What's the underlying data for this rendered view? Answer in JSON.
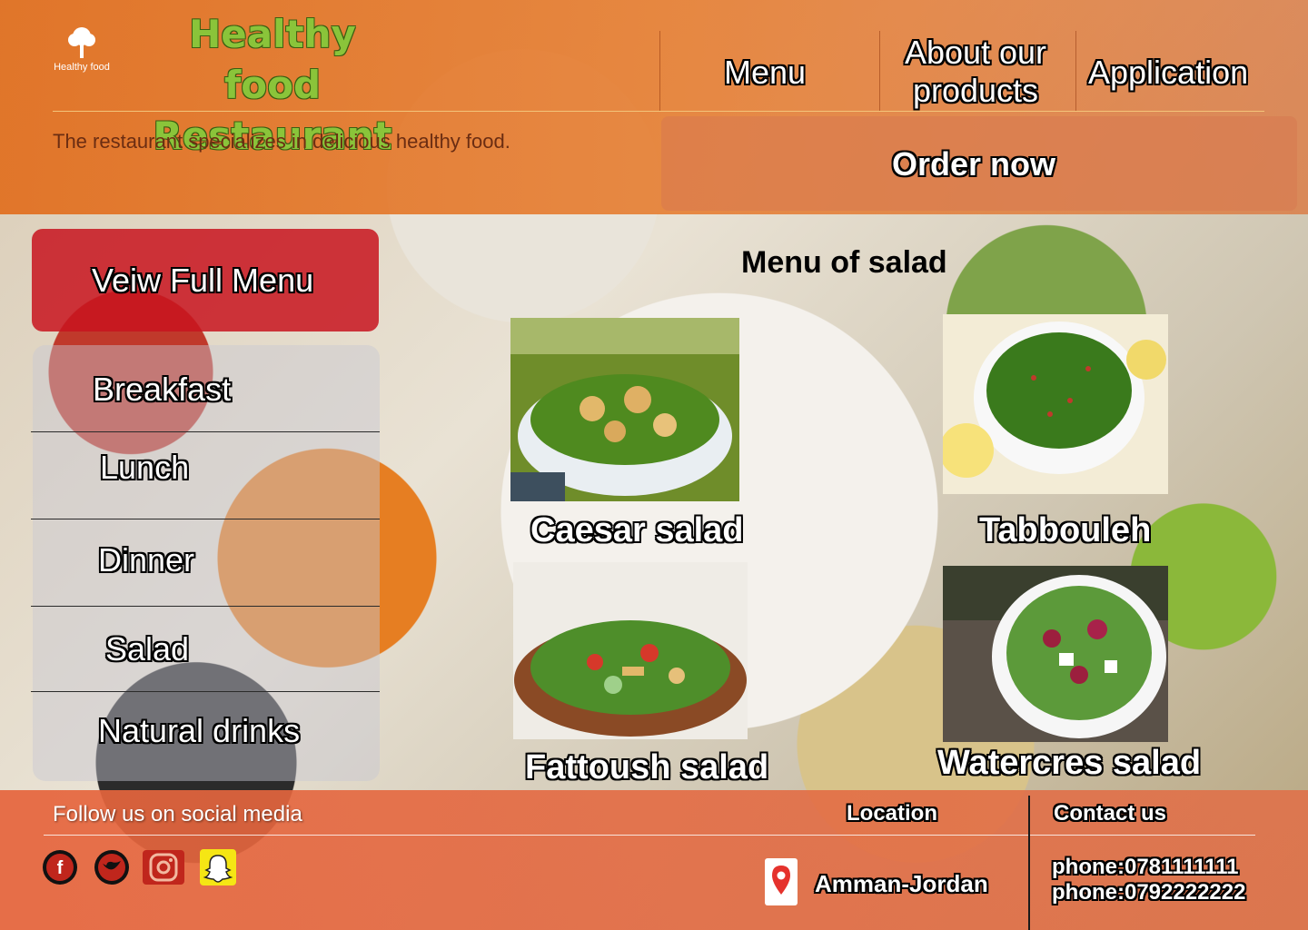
{
  "header": {
    "logo_caption": "Healthy food",
    "brand_line1": "Healthy food",
    "brand_line2": "Restaurant",
    "tagline": "The restaurant specializes in delicious healthy food.",
    "nav": {
      "menu": "Menu",
      "about_line1": "About our",
      "about_line2": "products",
      "application": "Application"
    },
    "order_now": "Order now"
  },
  "sidebar": {
    "full_menu": "Veiw Full Menu",
    "items": [
      {
        "label": "Breakfast"
      },
      {
        "label": "Lunch"
      },
      {
        "label": "Dinner"
      },
      {
        "label": "Salad"
      },
      {
        "label": "Natural drinks"
      }
    ]
  },
  "main": {
    "title": "Menu of salad",
    "dishes": [
      {
        "name": "Caesar salad"
      },
      {
        "name": "Tabbouleh"
      },
      {
        "name": "Fattoush salad"
      },
      {
        "name": "Watercres salad"
      }
    ]
  },
  "footer": {
    "follow": "Follow us on social media",
    "social": [
      {
        "icon": "facebook-icon"
      },
      {
        "icon": "twitter-icon"
      },
      {
        "icon": "instagram-icon"
      },
      {
        "icon": "snapchat-icon"
      }
    ],
    "location_title": "Location",
    "location_text": "Amman-Jordan",
    "contact_title": "Contact us",
    "phone1": "phone:0781111111",
    "phone2": "phone:0792222222"
  },
  "colors": {
    "header": "#e16e1e",
    "brand_green": "#8ac43a",
    "full_menu_red": "#c8141e",
    "footer": "#e6643c"
  }
}
